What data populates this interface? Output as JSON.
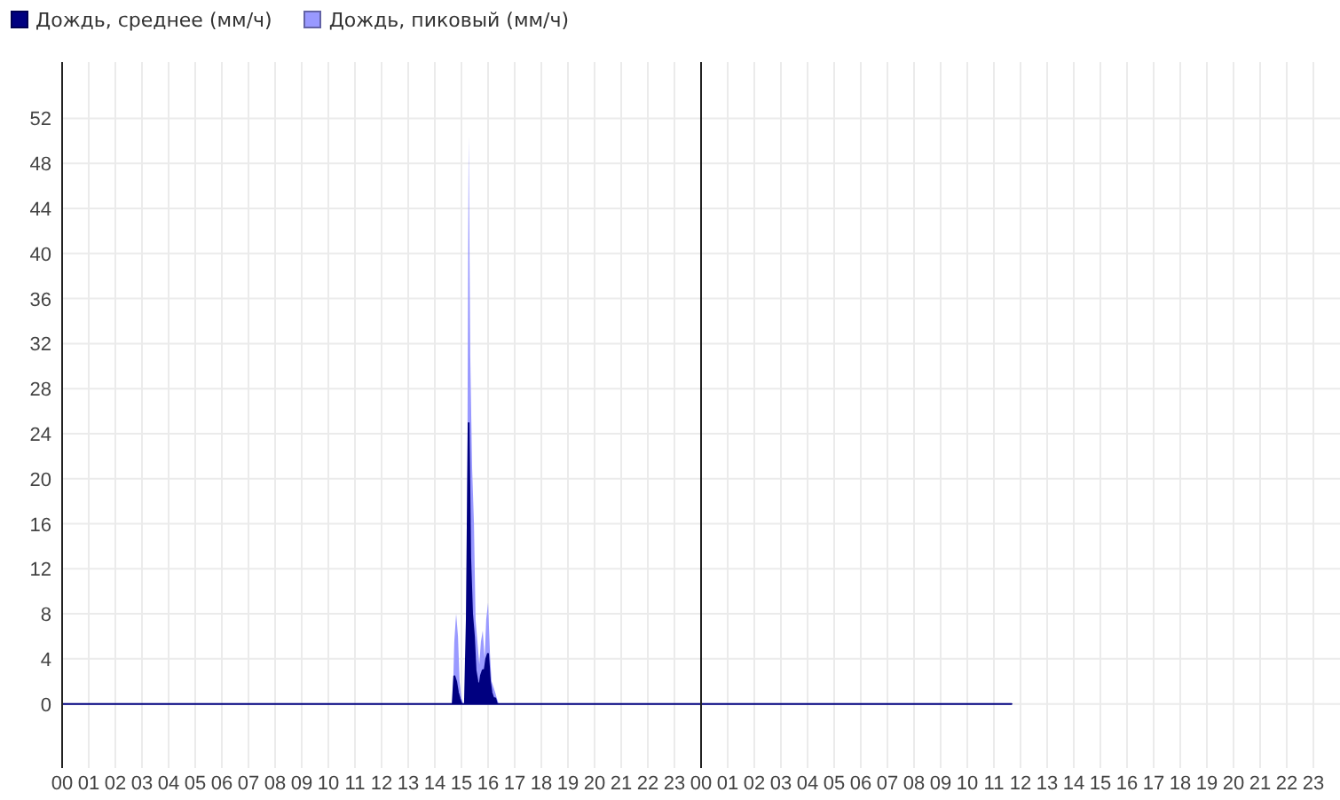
{
  "chart": {
    "chart_data": {
      "type": "area",
      "x": [
        0,
        14.67,
        14.73,
        14.8,
        14.87,
        14.93,
        15.0,
        15.07,
        15.13,
        15.2,
        15.27,
        15.33,
        15.4,
        15.47,
        15.53,
        15.6,
        15.67,
        15.73,
        15.8,
        15.87,
        15.93,
        16.0,
        16.07,
        16.13,
        16.2,
        16.27,
        16.33,
        16.4,
        35.67
      ],
      "series": [
        {
          "name": "Дождь, среднее (мм/ч)",
          "color": "#000080",
          "values": [
            0,
            0,
            2.5,
            2,
            1,
            0.5,
            0,
            0,
            0,
            7.5,
            25,
            13,
            8,
            6,
            3,
            2,
            1.5,
            2.5,
            3,
            3,
            4,
            4.5,
            2,
            1,
            0.5,
            0.5,
            0,
            0,
            0
          ]
        },
        {
          "name": "Дождь, пиковый (мм/ч)",
          "color": "#9999ff",
          "values": [
            0,
            0,
            5.5,
            8,
            6,
            2,
            0.5,
            0,
            0,
            8,
            50.5,
            31,
            21,
            16,
            7.5,
            5.5,
            3.5,
            5.5,
            6.5,
            4,
            7.5,
            9,
            4.5,
            2,
            1.5,
            1,
            0.5,
            0,
            0
          ]
        }
      ],
      "xlim": [
        0,
        48
      ],
      "ylim": [
        -5.7,
        57
      ],
      "xticks": [
        {
          "value": 0,
          "label": "00"
        },
        {
          "value": 1,
          "label": "01"
        },
        {
          "value": 2,
          "label": "02"
        },
        {
          "value": 3,
          "label": "03"
        },
        {
          "value": 4,
          "label": "04"
        },
        {
          "value": 5,
          "label": "05"
        },
        {
          "value": 6,
          "label": "06"
        },
        {
          "value": 7,
          "label": "07"
        },
        {
          "value": 8,
          "label": "08"
        },
        {
          "value": 9,
          "label": "09"
        },
        {
          "value": 10,
          "label": "10"
        },
        {
          "value": 11,
          "label": "11"
        },
        {
          "value": 12,
          "label": "12"
        },
        {
          "value": 13,
          "label": "13"
        },
        {
          "value": 14,
          "label": "14"
        },
        {
          "value": 15,
          "label": "15"
        },
        {
          "value": 16,
          "label": "16"
        },
        {
          "value": 17,
          "label": "17"
        },
        {
          "value": 18,
          "label": "18"
        },
        {
          "value": 19,
          "label": "19"
        },
        {
          "value": 20,
          "label": "20"
        },
        {
          "value": 21,
          "label": "21"
        },
        {
          "value": 22,
          "label": "22"
        },
        {
          "value": 23,
          "label": "23"
        },
        {
          "value": 24,
          "label": "00"
        },
        {
          "value": 25,
          "label": "01"
        },
        {
          "value": 26,
          "label": "02"
        },
        {
          "value": 27,
          "label": "03"
        },
        {
          "value": 28,
          "label": "04"
        },
        {
          "value": 29,
          "label": "05"
        },
        {
          "value": 30,
          "label": "06"
        },
        {
          "value": 31,
          "label": "07"
        },
        {
          "value": 32,
          "label": "08"
        },
        {
          "value": 33,
          "label": "09"
        },
        {
          "value": 34,
          "label": "10"
        },
        {
          "value": 35,
          "label": "11"
        },
        {
          "value": 36,
          "label": "12"
        },
        {
          "value": 37,
          "label": "13"
        },
        {
          "value": 38,
          "label": "14"
        },
        {
          "value": 39,
          "label": "15"
        },
        {
          "value": 40,
          "label": "16"
        },
        {
          "value": 41,
          "label": "17"
        },
        {
          "value": 42,
          "label": "18"
        },
        {
          "value": 43,
          "label": "19"
        },
        {
          "value": 44,
          "label": "20"
        },
        {
          "value": 45,
          "label": "21"
        },
        {
          "value": 46,
          "label": "22"
        },
        {
          "value": 47,
          "label": "23"
        }
      ],
      "yticks": [
        0,
        4,
        8,
        12,
        16,
        20,
        24,
        28,
        32,
        36,
        40,
        44,
        48,
        52
      ],
      "grid": true,
      "ref_lines": [
        {
          "axis": "x",
          "value": 24
        }
      ]
    }
  }
}
